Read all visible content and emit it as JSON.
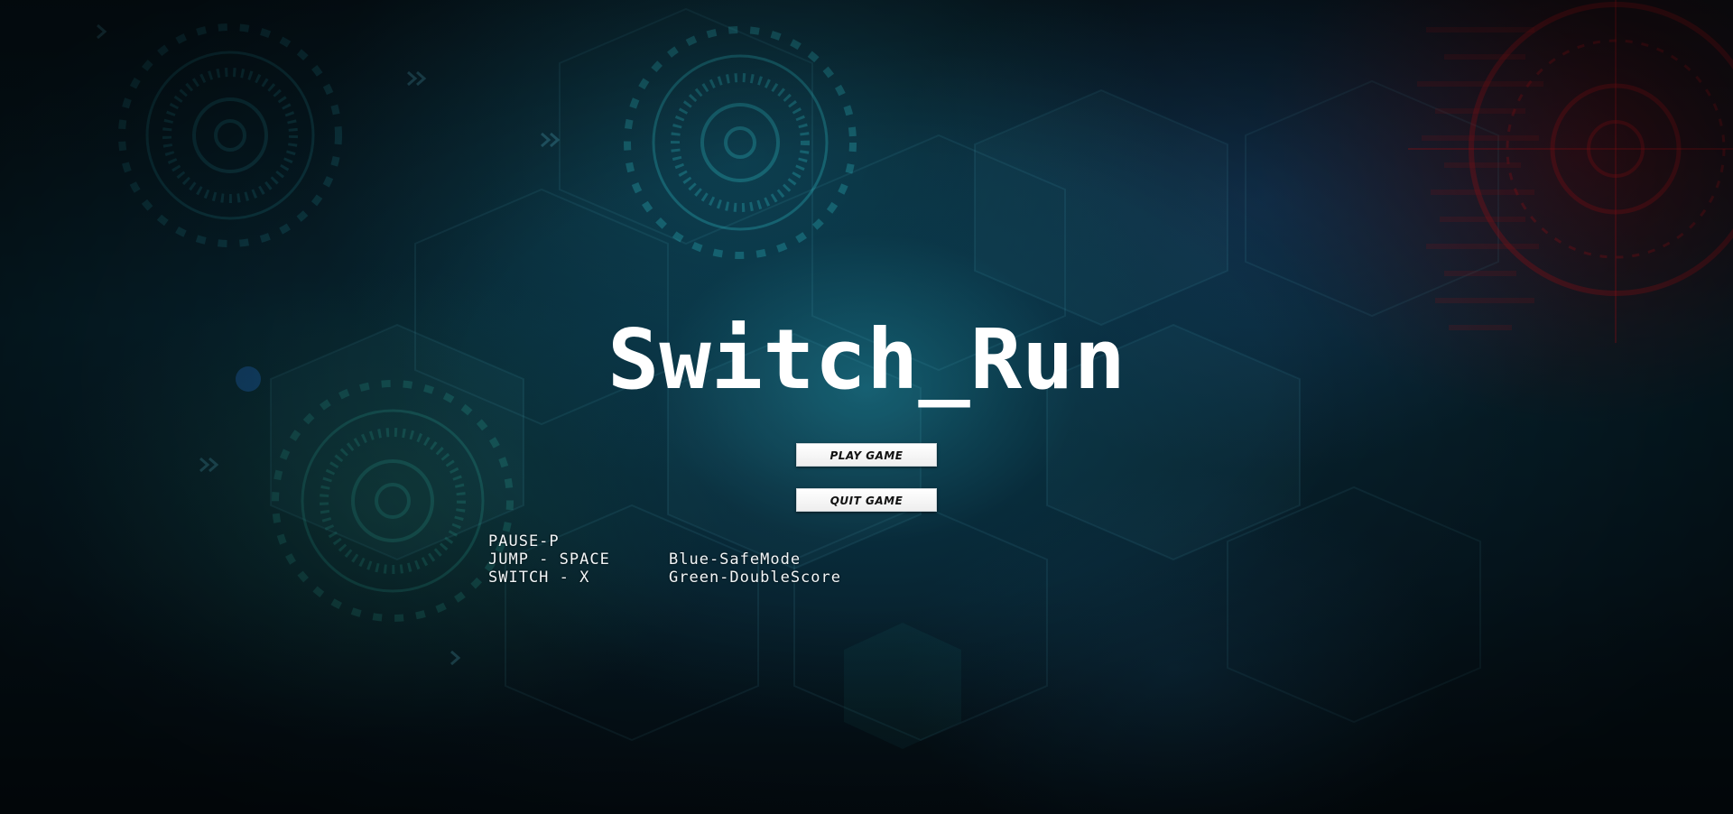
{
  "title": "Switch_Run",
  "menu": {
    "play_label": "PLAY GAME",
    "quit_label": "QUIT GAME"
  },
  "controls": {
    "pause": "PAUSE-P",
    "jump": "JUMP - SPACE",
    "switch": "SWITCH - X"
  },
  "modes": {
    "blue": "Blue-SafeMode",
    "green": "Green-DoubleScore"
  },
  "colors": {
    "title": "#ffffff",
    "button_bg": "#ffffff",
    "button_text": "#111111",
    "background": "#072531",
    "accent_red": "#8a0a12"
  }
}
